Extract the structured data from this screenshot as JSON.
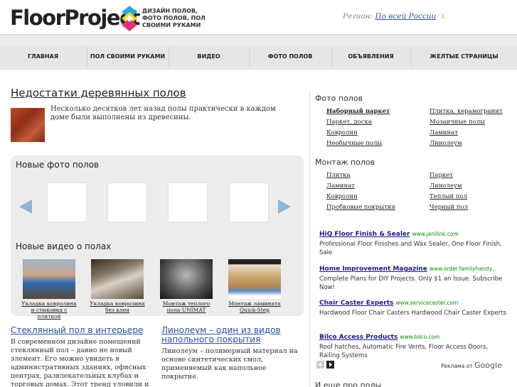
{
  "header": {
    "logo": "FloorProject",
    "tagline": "ДИЗАЙН ПОЛОВ, ФОТО ПОЛОВ, ПОЛ СВОИМИ РУКАМИ",
    "region_label": "Регион:",
    "region_value": "По всей России",
    "region_arrow": "↓"
  },
  "nav": [
    {
      "label": "ГЛАВНАЯ"
    },
    {
      "label": "ПОЛ СВОИМИ РУКАМИ"
    },
    {
      "label": "ВИДЕО"
    },
    {
      "label": "ФОТО ПОЛОВ"
    },
    {
      "label": "ОБЪЯВЛЕНИЯ"
    },
    {
      "label": "ЖЕЛТЫЕ СТРАНИЦЫ"
    }
  ],
  "main": {
    "title": "Недостатки деревянных полов",
    "intro": "Несколько десятков лет назад полы практически в каждом доме были выполнены из древесины.",
    "photos_title": "Новые фото полов",
    "videos_title": "Новые видео о полах",
    "videos": [
      {
        "caption": "Укладка ковролина и стыковка с плиткой"
      },
      {
        "caption": "Укладка ковролина без клея"
      },
      {
        "caption": "Монтаж теплого пола UNIMAT"
      },
      {
        "caption": "Монтаж ламината Quick-Step"
      }
    ],
    "articles": [
      {
        "title": "Стеклянный пол в интерьере",
        "text": "В современном дизайне помещений стеклянный пол – давно не новый элемент. Его можно увидеть в административных зданиях, офисных центрах, развлекательных клубах и торговых домах. Этот тренд уловили и"
      },
      {
        "title": "Линолеум – один из видов напольного покрытия",
        "text": "Линолеум – полимерный материал на основе синтетических смол, применяемый как напольное покрытие."
      }
    ]
  },
  "sidebar": {
    "photo_title": "Фото полов",
    "photo_links": [
      {
        "label": "Наборный паркет"
      },
      {
        "label": "Плитка, керамогранит"
      },
      {
        "label": "Паркет, доска"
      },
      {
        "label": "Мозаичные полы"
      },
      {
        "label": "Ковролин"
      },
      {
        "label": "Ламинат"
      },
      {
        "label": "Необычные полы"
      },
      {
        "label": "Линолеум"
      }
    ],
    "mount_title": "Монтаж полов",
    "mount_links": [
      {
        "label": "Плитка"
      },
      {
        "label": "Паркет"
      },
      {
        "label": "Ламинат"
      },
      {
        "label": "Линолеум"
      },
      {
        "label": "Ковролин"
      },
      {
        "label": "Теплый пол"
      },
      {
        "label": "Пробковые покрытия"
      },
      {
        "label": "Черный пол"
      }
    ],
    "ads": [
      {
        "title": "HiQ Floor Finish & Sealer",
        "url": "www.janilink.com",
        "text": "Professional Floor Finishes and Wax Sealer, One Floor Finish, Sale"
      },
      {
        "title": "Home Improvement Magazine",
        "url": "www.order.familyhandy...",
        "text": "Complete Plans for DIY Projects. Only $1 an Issue. Subscribe Now!"
      },
      {
        "title": "Chair Caster Experts",
        "url": "www.servicecaster.com",
        "text": "Hardwood Floor Chair Casters Hardwood Chair Caster Experts"
      },
      {
        "title": "Bilco Access Products",
        "url": "www.bilco.com",
        "text": "Roof hatches, Automatic Fire Vents, Floor Access Doors, Railing Systems"
      }
    ],
    "ads_by": "Реклама от",
    "ads_brand": "Google",
    "more_title": "И еще про полы"
  },
  "colors": {
    "link_blue": "#2a4ea8",
    "ad_title": "#1a1a8c",
    "ad_url": "#0a8a0a",
    "nav_bg": "#ececec",
    "arrow": "#8fb4d4"
  }
}
